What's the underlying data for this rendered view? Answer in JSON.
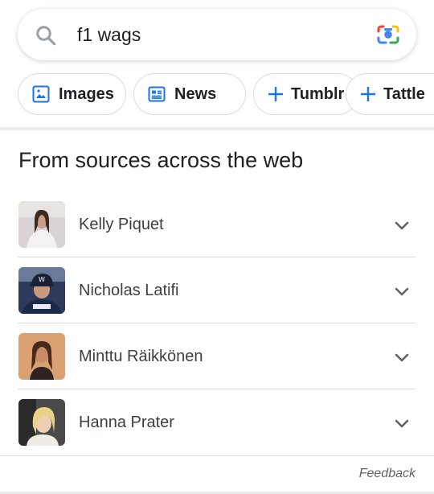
{
  "search": {
    "query": "f1 wags",
    "search_icon": "search-icon",
    "lens_icon": "google-lens-icon"
  },
  "chips": [
    {
      "label": "Images",
      "icon": "image-icon"
    },
    {
      "label": "News",
      "icon": "news-icon"
    },
    {
      "label": "Tumblr",
      "icon": "plus-icon"
    },
    {
      "label": "Tattle",
      "icon": "plus-icon"
    }
  ],
  "section": {
    "title": "From sources across the web"
  },
  "results": [
    {
      "name": "Kelly Piquet",
      "icon": "chevron-down-icon"
    },
    {
      "name": "Nicholas Latifi",
      "icon": "chevron-down-icon"
    },
    {
      "name": "Minttu Räikkönen",
      "icon": "chevron-down-icon"
    },
    {
      "name": "Hanna Prater",
      "icon": "chevron-down-icon"
    }
  ],
  "footer": {
    "feedback": "Feedback"
  },
  "colors": {
    "accent_blue": "#1a73e8",
    "text": "#202124",
    "secondary_text": "#3c4043",
    "border": "#dadce0"
  }
}
